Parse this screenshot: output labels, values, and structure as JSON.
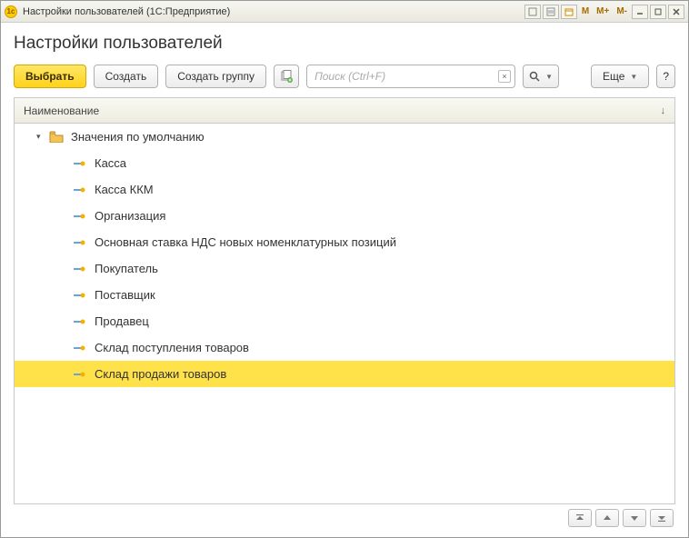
{
  "titlebar": {
    "title": "Настройки пользователей  (1С:Предприятие)",
    "mem_buttons": [
      "M",
      "M+",
      "M-"
    ]
  },
  "page": {
    "heading": "Настройки пользователей"
  },
  "toolbar": {
    "select": "Выбрать",
    "create": "Создать",
    "create_group": "Создать группу",
    "search_placeholder": "Поиск (Ctrl+F)",
    "more": "Еще",
    "help": "?"
  },
  "grid": {
    "header": "Наименование",
    "sort_indicator": "↓",
    "group": {
      "label": "Значения по умолчанию"
    },
    "items": [
      {
        "label": "Касса"
      },
      {
        "label": "Касса ККМ"
      },
      {
        "label": "Организация"
      },
      {
        "label": "Основная ставка НДС новых номенклатурных позиций"
      },
      {
        "label": "Покупатель"
      },
      {
        "label": "Поставщик"
      },
      {
        "label": "Продавец"
      },
      {
        "label": "Склад поступления товаров"
      },
      {
        "label": "Склад продажи товаров"
      }
    ],
    "selected_index": 8
  }
}
